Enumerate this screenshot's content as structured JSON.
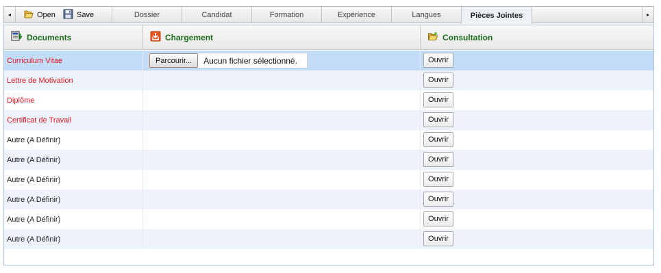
{
  "toolbar": {
    "scroll_left": "◂",
    "scroll_right": "▸",
    "open_label": "Open",
    "save_label": "Save",
    "open_icon": "folder-open-icon",
    "save_icon": "floppy-disk-icon",
    "tabs": [
      {
        "label": "Dossier"
      },
      {
        "label": "Candidat"
      },
      {
        "label": "Formation"
      },
      {
        "label": "Expérience"
      },
      {
        "label": "Langues"
      },
      {
        "label": "Pièces Jointes",
        "active": true
      }
    ]
  },
  "grid": {
    "headers": {
      "documents": "Documents",
      "chargement": "Chargement",
      "consultation": "Consultation"
    },
    "header_color": "#1c6d1c",
    "required_color": "#e0141e",
    "selected_row_color": "#c3dcf7",
    "alt_row_color": "#eef3fb",
    "file_input": {
      "browse_label": "Parcourir...",
      "status": "Aucun fichier sélectionné."
    },
    "open_button_label": "Ouvrir",
    "rows": [
      {
        "label": "Curriculum Vitae",
        "required": true,
        "selected": true
      },
      {
        "label": "Lettre de Motivation",
        "required": true
      },
      {
        "label": "Diplôme",
        "required": true
      },
      {
        "label": "Certificat de Travail",
        "required": true
      },
      {
        "label": "Autre (A Définir)"
      },
      {
        "label": "Autre (A Définir)"
      },
      {
        "label": "Autre (A Définir)"
      },
      {
        "label": "Autre (A Définir)"
      },
      {
        "label": "Autre (A Définir)"
      },
      {
        "label": "Autre (A Définir)"
      }
    ]
  }
}
